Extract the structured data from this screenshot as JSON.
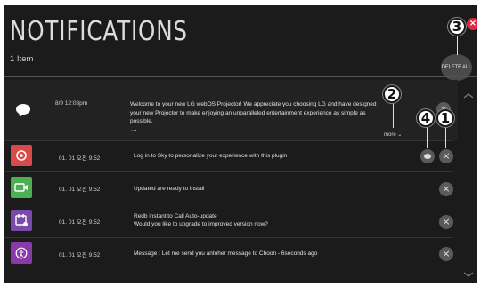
{
  "header": {
    "title": "NOTIFICATIONS",
    "count": "1 Item",
    "delete_all": "DELETE ALL"
  },
  "notifications": [
    {
      "icon": "chat-icon",
      "time": "8/9 12:03pm",
      "message": "Welcome to your new LG webOS Projector! We appreciate you choosing LG and have designed your new Projector to make enjoying an unparalleled entertainment experience as simple as possible.",
      "ellipsis": "...",
      "more": "more ⌄"
    },
    {
      "icon": "sky-app-icon",
      "icon_color": "#d94a4a",
      "time": "01. 01 오전 9:52",
      "message": "Log in to Sky to personalize your experience with this plugin"
    },
    {
      "icon": "update-app-icon",
      "icon_color": "#4caf50",
      "time": "01. 01 오전 9:52",
      "message": "Updated are ready to install"
    },
    {
      "icon": "calendar-app-icon",
      "icon_color": "#7b4aa8",
      "time": "01. 01 오전 9:52",
      "message": "Redb instant to Call Auto-update\nWould you like to upgrade to improved version now?"
    },
    {
      "icon": "accessibility-app-icon",
      "icon_color": "#8a3aa8",
      "time": "01. 01 오전 9:52",
      "message": "Message : Let me send you antoher message to Choon - 6seconds ago"
    }
  ],
  "callouts": [
    "1",
    "2",
    "3",
    "4"
  ],
  "colors": {
    "background": "#1b1b1b",
    "callout_close": "#e0283f"
  }
}
